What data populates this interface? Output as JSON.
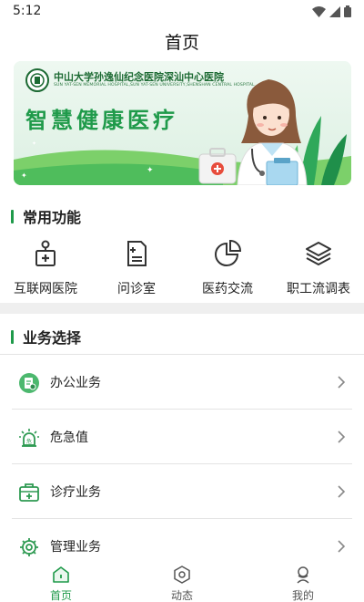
{
  "status_bar": {
    "time": "5:12"
  },
  "header": {
    "title": "首页"
  },
  "banner": {
    "hospital_name": "中山大学孙逸仙纪念医院深汕中心医院",
    "hospital_name_en": "SUN YAT-SEN MEMORIAL HOSPITAL,SUN YAT-SEN UNIVERSITY,SHENSHAN CENTRAL HOSPITAL",
    "slogan": "智慧健康医疗"
  },
  "common_functions": {
    "title": "常用功能",
    "items": [
      {
        "label": "互联网医院",
        "icon": "hospital-icon"
      },
      {
        "label": "问诊室",
        "icon": "consultation-icon"
      },
      {
        "label": "医药交流",
        "icon": "pie-chart-icon"
      },
      {
        "label": "职工流调表",
        "icon": "layers-icon"
      }
    ]
  },
  "business": {
    "title": "业务选择",
    "items": [
      {
        "label": "办公业务",
        "icon": "office-icon"
      },
      {
        "label": "危急值",
        "icon": "alarm-icon"
      },
      {
        "label": "诊疗业务",
        "icon": "medical-kit-icon"
      },
      {
        "label": "管理业务",
        "icon": "settings-icon"
      }
    ]
  },
  "bottom_nav": {
    "items": [
      {
        "label": "首页",
        "active": true
      },
      {
        "label": "动态",
        "active": false
      },
      {
        "label": "我的",
        "active": false
      }
    ]
  },
  "colors": {
    "accent": "#1f9a4a",
    "text": "#222222",
    "divider": "#e4e4e4"
  }
}
